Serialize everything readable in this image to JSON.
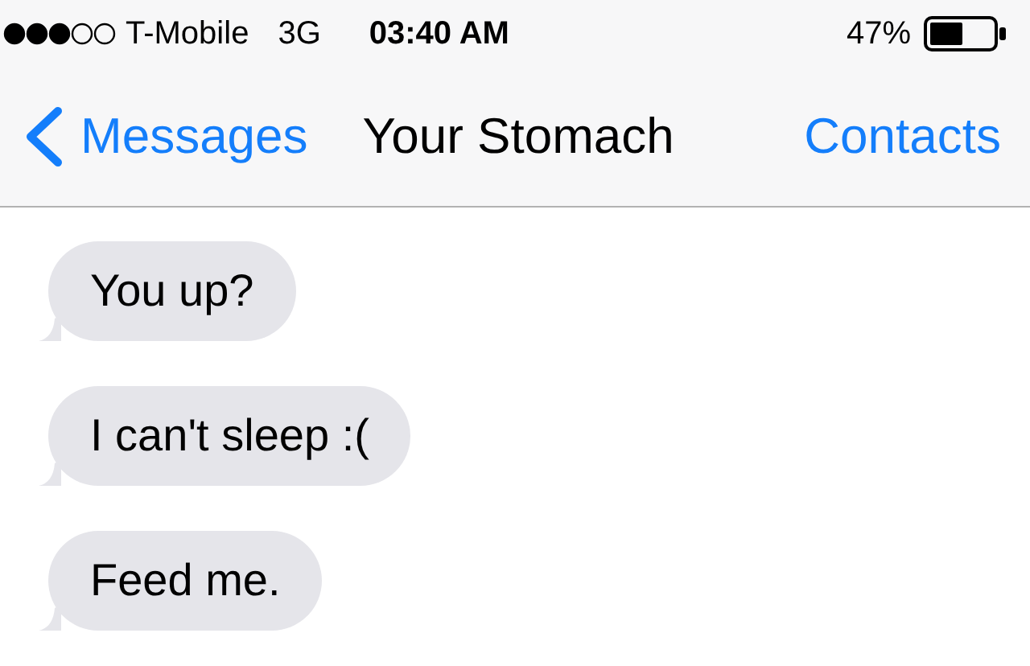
{
  "status_bar": {
    "carrier": "T-Mobile",
    "network": "3G",
    "time": "03:40 AM",
    "battery": "47%"
  },
  "nav_bar": {
    "back": "Messages",
    "title": "Your Stomach",
    "action": "Contacts"
  },
  "messages": [
    {
      "kind": "received",
      "text": "You up?"
    },
    {
      "kind": "received",
      "text": "I can't sleep :("
    },
    {
      "kind": "received",
      "text": "Feed me."
    }
  ]
}
